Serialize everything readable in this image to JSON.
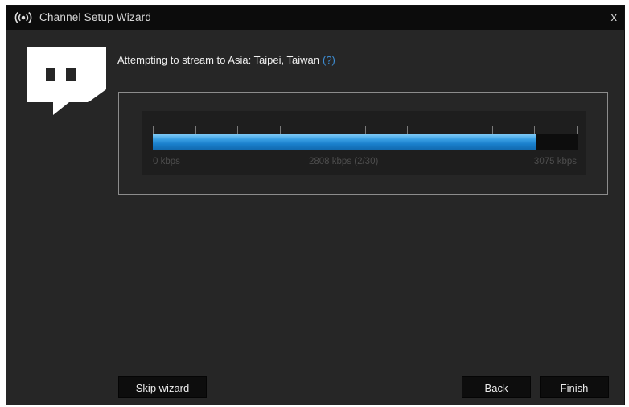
{
  "window": {
    "title": "Channel Setup Wizard",
    "title_icon": "broadcast-icon",
    "close_label": "x"
  },
  "main": {
    "logo_icon": "twitch-logo",
    "message": "Attempting to stream to Asia: Taipei, Taiwan",
    "help_link": "(?)"
  },
  "meter": {
    "progress_fraction": 0.904,
    "min_label": "0 kbps",
    "current_label": "2808 kbps (2/30)",
    "max_label": "3075 kbps",
    "tick_count": 11
  },
  "buttons": {
    "skip": "Skip wizard",
    "back": "Back",
    "finish": "Finish"
  },
  "colors": {
    "accent": "#1a7fcc",
    "link": "#3e8fd6",
    "background": "#262626"
  }
}
